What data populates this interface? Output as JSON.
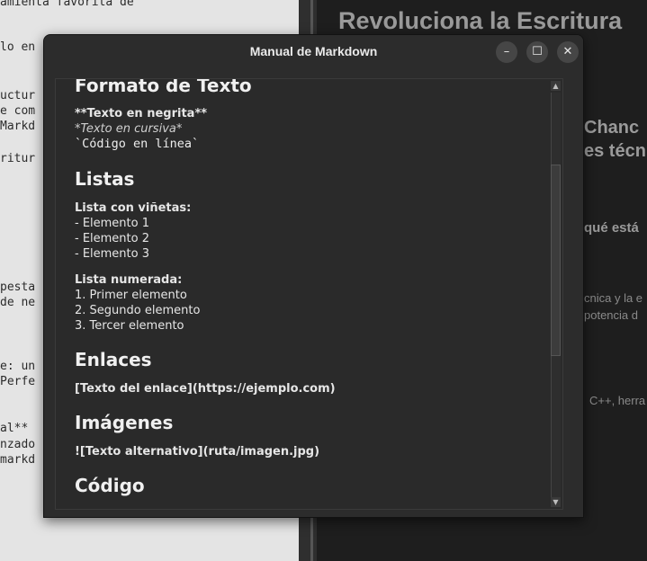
{
  "editor": {
    "lines": [
      "amienta favorita de",
      "lo en",
      "uctur",
      "e com",
      "Markd",
      "ritur",
      "pesta",
      "de ne",
      "e: un",
      "Perfe",
      "al**",
      "nzado",
      "markd"
    ]
  },
  "preview": {
    "title": "Revoluciona la Escritura",
    "h2_a": "Chanc",
    "h2_b": "es técn",
    "h3": "qué está",
    "p1": "cnica y la e",
    "p2": "potencia d",
    "p3": "C++, herra"
  },
  "dialog": {
    "title": "Manual de Markdown",
    "minimize_symbol": "–",
    "maximize_symbol": "☐",
    "close_symbol": "✕",
    "sections": {
      "format_heading": "Formato de Texto",
      "bold_example": "**Texto en negrita**",
      "italic_example": "*Texto en cursiva*",
      "code_example": "`Código en línea`",
      "lists_heading": "Listas",
      "bullet_label": "Lista con viñetas:",
      "bullet_items": [
        "- Elemento 1",
        "- Elemento 2",
        "- Elemento 3"
      ],
      "numbered_label": "Lista numerada:",
      "numbered_items": [
        "1. Primer elemento",
        "2. Segundo elemento",
        "3. Tercer elemento"
      ],
      "links_heading": "Enlaces",
      "link_example": "[Texto del enlace](https://ejemplo.com)",
      "images_heading": "Imágenes",
      "image_example": "![Texto alternativo](ruta/imagen.jpg)",
      "code_heading": "Código"
    }
  },
  "scrollbar": {
    "up_symbol": "▲",
    "down_symbol": "▼"
  }
}
